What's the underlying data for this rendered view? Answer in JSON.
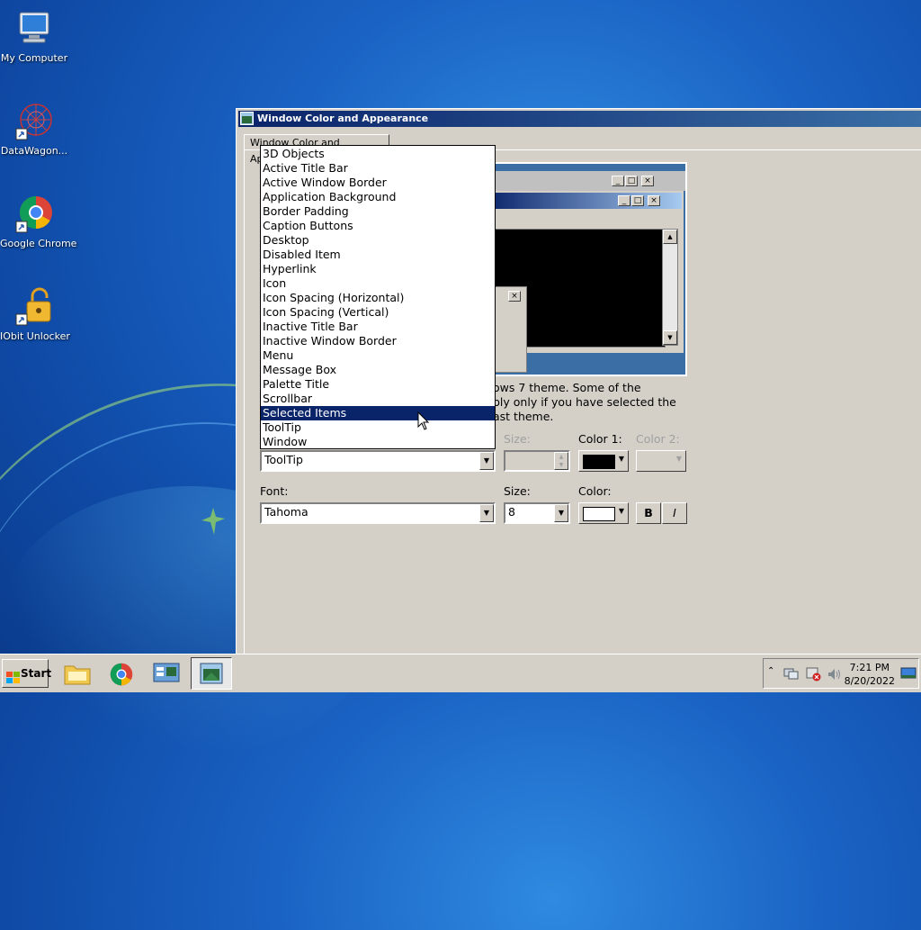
{
  "desktop": {
    "icons": [
      {
        "label": "My Computer",
        "icon": "my-computer-icon"
      },
      {
        "label": "DataWagon...",
        "icon": "datawagon-icon"
      },
      {
        "label": "Google Chrome",
        "icon": "chrome-icon"
      },
      {
        "label": "IObit Unlocker",
        "icon": "iobit-unlocker-icon"
      }
    ]
  },
  "window": {
    "title": "Window Color and Appearance",
    "tab_label": "Window Color and Appearance",
    "info_text_line1": "ows 7 theme.  Some of the",
    "info_text_line2": "ply only if you have selected the",
    "info_text_line3": "ast theme.",
    "item": {
      "selected_value": "ToolTip",
      "size_label": "Size:",
      "color1_label": "Color 1:",
      "color2_label": "Color 2:",
      "color1": "#000000"
    },
    "font": {
      "label": "Font:",
      "value": "Tahoma",
      "size_label": "Size:",
      "size_value": "8",
      "color_label": "Color:",
      "color": "#ffffff",
      "bold_label": "B",
      "italic_label": "I"
    }
  },
  "dropdown": {
    "items": [
      "3D Objects",
      "Active Title Bar",
      "Active Window Border",
      "Application Background",
      "Border Padding",
      "Caption Buttons",
      "Desktop",
      "Disabled Item",
      "Hyperlink",
      "Icon",
      "Icon Spacing (Horizontal)",
      "Icon Spacing (Vertical)",
      "Inactive Title Bar",
      "Inactive Window Border",
      "Menu",
      "Message Box",
      "Palette Title",
      "Scrollbar",
      "Selected Items",
      "ToolTip",
      "Window"
    ],
    "highlighted_index": 18
  },
  "taskbar": {
    "start_label": "Start",
    "time": "7:21 PM",
    "date": "8/20/2022"
  }
}
